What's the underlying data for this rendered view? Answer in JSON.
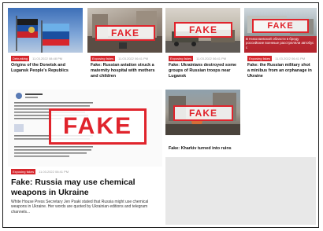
{
  "cards": [
    {
      "category": "Debunking",
      "date": "11.03.2022 08:48 PM",
      "title": "Origins of the Donetsk and Lugansk People's Republics",
      "stamp": ""
    },
    {
      "category": "Exposing fakes",
      "date": "11.03.2022 06:41 PM",
      "title": "Fake: Russian aviation struck a maternity hospital with mothers and children",
      "stamp": "FAKE"
    },
    {
      "category": "Exposing fakes",
      "date": "11.03.2022 06:41 PM",
      "title": "Fake: Ukrainians destroyed some groups of Russian troops near Lugansk",
      "stamp": "FAKE"
    },
    {
      "category": "Exposing fakes",
      "date": "11.03.2022 06:41 PM",
      "title": "Fake: the Russian military shot a minibus from an orphanage in Ukraine",
      "stamp": "FAKE",
      "overlay_text": "В Николаевской области в бреду российские военные расстреляли автобус с"
    },
    {
      "category": "Exposing fakes",
      "date": "11.03.2022 06:41 PM",
      "title": "Fake: Russia may use chemical weapons in Ukraine",
      "stamp": "FAKE",
      "excerpt": "White House Press Secretary Jen Psaki stated that Russia might use chemical weapons in Ukraine. Her words are quoted by Ukrainian editions and telegram channels..."
    },
    {
      "category": "",
      "date": "",
      "title": "Fake: Kharkiv turned into ruins",
      "stamp": "FAKE"
    }
  ],
  "colors": {
    "accent": "#d6262c",
    "stamp": "#e0242c",
    "panel": "#e8e8e8"
  }
}
